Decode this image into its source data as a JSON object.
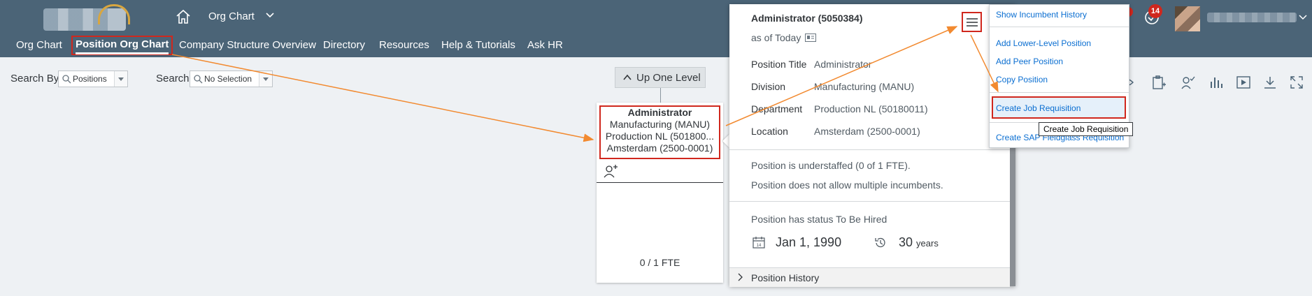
{
  "header": {
    "app_title": "Org Chart",
    "notification_count": "14"
  },
  "nav": {
    "items": [
      "Org Chart",
      "Position Org Chart",
      "Company Structure Overview",
      "Directory",
      "Resources",
      "Help & Tutorials",
      "Ask HR"
    ],
    "active": "Position Org Chart"
  },
  "search": {
    "by_label": "Search By",
    "by_value": "Positions",
    "search_label": "Search",
    "search_value": "No Selection"
  },
  "up_level_label": "Up One Level",
  "node": {
    "title": "Administrator",
    "division": "Manufacturing (MANU)",
    "department": "Production NL (501800...",
    "location": "Amsterdam (2500-0001)",
    "fte": "0 / 1 FTE"
  },
  "popover": {
    "title": "Administrator (5050384)",
    "as_of": "as of Today",
    "fields": [
      {
        "label": "Position Title",
        "value": "Administrator"
      },
      {
        "label": "Division",
        "value": "Manufacturing (MANU)"
      },
      {
        "label": "Department",
        "value": "Production NL (50180011)"
      },
      {
        "label": "Location",
        "value": "Amsterdam (2500-0001)"
      }
    ],
    "understaffed": "Position is understaffed (0 of 1 FTE).",
    "multi_incumbents": "Position does not allow multiple incumbents.",
    "status": "Position has status To Be Hired",
    "date": "Jan 1, 1990",
    "years_value": "30",
    "years_unit": "years",
    "history_label": "Position History"
  },
  "menu": {
    "items": [
      "Show Incumbent History",
      "Add Lower-Level Position",
      "Add Peer Position",
      "Copy Position",
      "Create Job Requisition",
      "Create SAP Fieldglass Requisition"
    ],
    "tooltip": "Create Job Requisition"
  },
  "colors": {
    "header_bg": "#4b6477",
    "highlight_red": "#d0271d",
    "arrow_orange": "#f28a30",
    "link_blue": "#0a6ed1"
  },
  "icons": [
    "home-icon",
    "chevron-down-icon",
    "check-task-icon",
    "search-icon",
    "chevron-up-icon",
    "add-person-icon",
    "id-card-icon",
    "calendar-icon",
    "history-icon",
    "menu-icon",
    "eye-icon",
    "clipboard-add-icon",
    "person-check-icon",
    "bar-chart-icon",
    "play-icon",
    "download-icon",
    "fullscreen-icon"
  ]
}
